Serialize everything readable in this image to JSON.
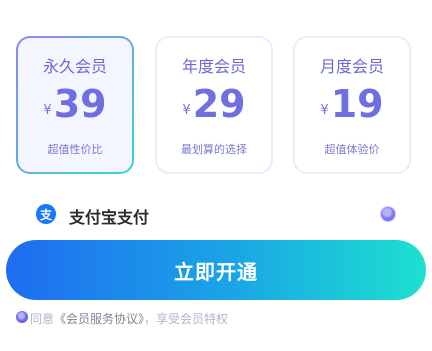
{
  "plans": [
    {
      "name": "永久会员",
      "currency": "¥",
      "price": "39",
      "desc": "超值性价比",
      "selected": true
    },
    {
      "name": "年度会员",
      "currency": "¥",
      "price": "29",
      "desc": "最划算的选择",
      "selected": false
    },
    {
      "name": "月度会员",
      "currency": "¥",
      "price": "19",
      "desc": "超值体验价",
      "selected": false
    }
  ],
  "payment": {
    "icon": "alipay-icon",
    "icon_glyph": "支",
    "label": "支付宝支付",
    "selected": true
  },
  "cta": {
    "label": "立即开通"
  },
  "agreement": {
    "prefix": "同意",
    "link": "《会员服务协议》",
    "suffix": "，享受会员特权",
    "checked": true
  },
  "colors": {
    "accent": "#6f6fe2",
    "cta_start": "#1f6cf0",
    "cta_end": "#1de0d0",
    "alipay": "#1677ff"
  }
}
